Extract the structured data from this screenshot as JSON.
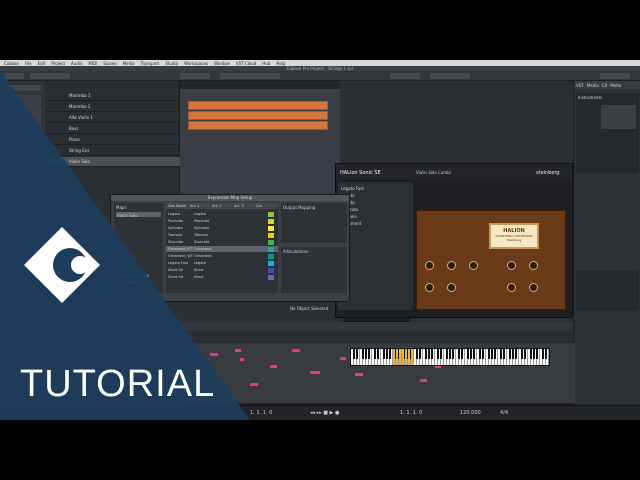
{
  "menubar": {
    "items": [
      "Cubase",
      "File",
      "Edit",
      "Project",
      "Audio",
      "MIDI",
      "Scores",
      "Media",
      "Transport",
      "Studio",
      "Workspaces",
      "Window",
      "VST Cloud",
      "Hub",
      "Help"
    ]
  },
  "window": {
    "title": "Cubase Pro Project - Strings 1.cpr"
  },
  "tracks": [
    {
      "name": "Marimba 1"
    },
    {
      "name": "Marimba 2"
    },
    {
      "name": "Alto Violin 1"
    },
    {
      "name": "Bass"
    },
    {
      "name": "Piano"
    },
    {
      "name": "String Ens"
    },
    {
      "name": "Violin Solo"
    }
  ],
  "expression_maps": {
    "title": "Expression Map Setup",
    "maps_label": "Maps",
    "selected_map": "Violin Solo",
    "columns": [
      "Slot Name",
      "Art. 1",
      "Art. 2",
      "Art. 3",
      "Col."
    ],
    "rows": [
      {
        "name": "Legato",
        "art": "Legato"
      },
      {
        "name": "Pizzicato",
        "art": "Pizzicato"
      },
      {
        "name": "Spiccato",
        "art": "Spiccato"
      },
      {
        "name": "Tremolo",
        "art": "Tremolo"
      },
      {
        "name": "Staccato",
        "art": "Staccato"
      },
      {
        "name": "Ornament_HT",
        "art": "Ornament"
      },
      {
        "name": "Ornament_WT",
        "art": "Ornament"
      },
      {
        "name": "Legato Fast",
        "art": "Legato"
      },
      {
        "name": "Short All",
        "art": "Short"
      },
      {
        "name": "Short Alt",
        "art": "Short"
      }
    ],
    "output_title": "Output Mapping",
    "articulations_title": "Articulations",
    "remote_title": "Remote Settings",
    "remote_value": "Key Switches"
  },
  "halion": {
    "title": "HALion Sonic SE",
    "preset": "Violin Solo Combi",
    "brand": "steinberg",
    "logo_line1": "HALION",
    "logo_line2": "SYMPHONIC ORCHESTRA",
    "logo_line3": "Steinberg",
    "articulations": [
      "Legato Fast",
      "Legato",
      "Legato",
      "Pizzicato",
      "Tremolo",
      "Ornament"
    ]
  },
  "key_editor": {
    "status": "No Object Selected"
  },
  "transport": {
    "left_position": "1. 1. 1. 0",
    "right_position": "1. 1. 1. 0",
    "tempo": "120.000",
    "signature": "4/4"
  },
  "right_panel": {
    "tabs": [
      "VST",
      "Media",
      "CR",
      "Meter"
    ],
    "rack_label": "Instruments"
  },
  "overlay": {
    "label": "TUTORIAL"
  },
  "colors": {
    "overlay_blue": "#1d3d5c",
    "note_color": "#e23c7a",
    "event_orange": "#d7763a"
  }
}
